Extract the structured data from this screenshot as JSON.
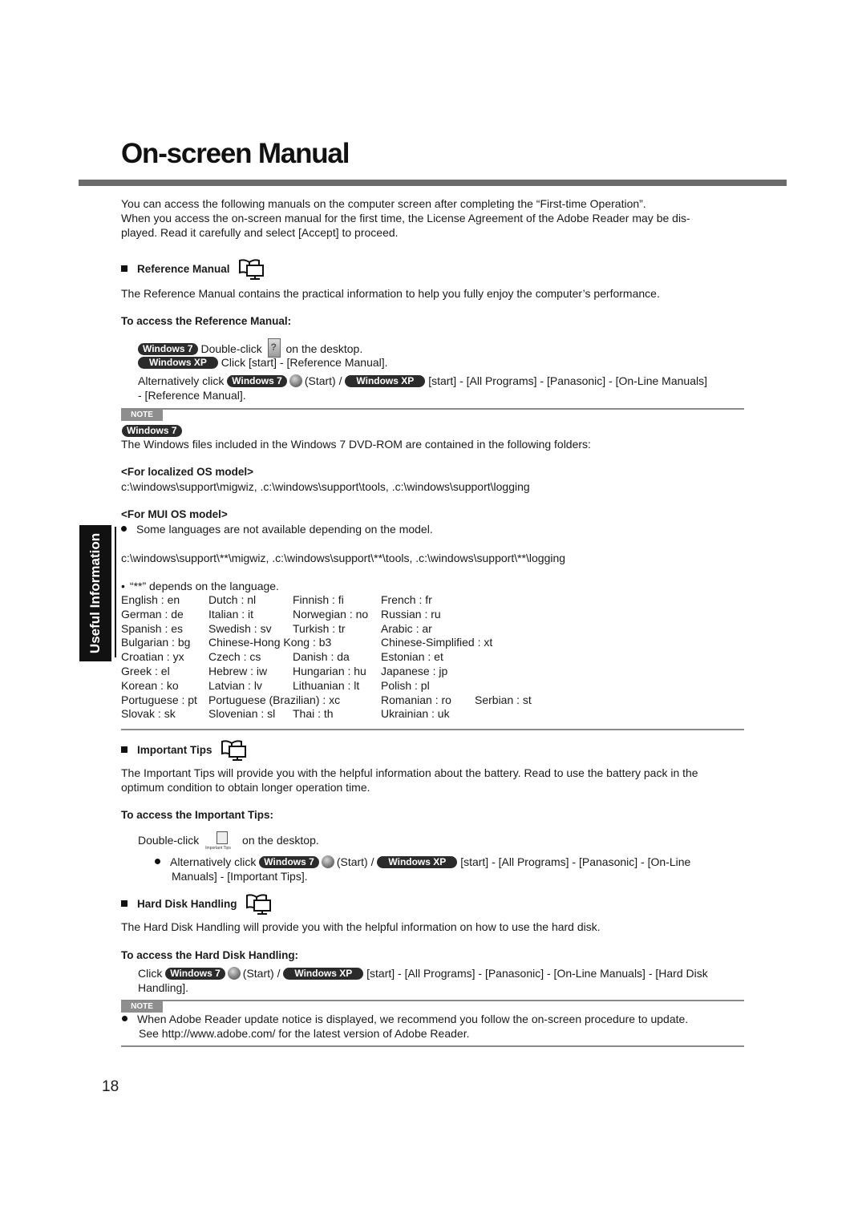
{
  "page": {
    "title": "On-screen Manual",
    "side_tab": "Useful Information",
    "page_number": "18"
  },
  "intro": {
    "line1": "You can access the following manuals on the computer screen after completing the “First-time Operation”.",
    "line2": "When you access the on-screen manual for the first time, the License Agreement of the Adobe Reader may be dis-",
    "line3": "played. Read it carefully and select [Accept] to proceed."
  },
  "badges": {
    "win7": "Windows 7",
    "winxp": "Windows XP",
    "note": "NOTE"
  },
  "reference_manual": {
    "heading": "Reference Manual",
    "description": "The Reference Manual contains the practical information to help you fully enjoy the computer’s performance.",
    "access_heading": "To access the Reference Manual:",
    "win7_pre": "Double-click",
    "win7_post": "on the desktop.",
    "xp_text": "Click [start] - [Reference Manual].",
    "alt_pre": "Alternatively click",
    "alt_start": "(Start) /",
    "alt_path": "[start] - [All Programs] - [Panasonic] - [On-Line Manuals]",
    "alt_path2": "- [Reference Manual]."
  },
  "note1": {
    "text": "The Windows files included in the Windows 7 DVD-ROM are contained in the following folders:",
    "localized_heading": "<For localized OS model>",
    "localized_path": "c:\\windows\\support\\migwiz, .c:\\windows\\support\\tools, .c:\\windows\\support\\logging",
    "mui_heading": "<For MUI OS model>",
    "mui_bullet": "Some languages are not available depending on the model.",
    "mui_path": "c:\\windows\\support\\**\\migwiz, .c:\\windows\\support\\**\\tools, .c:\\windows\\support\\**\\logging",
    "depends": "“**” depends on the language.",
    "languages": [
      [
        "English : en",
        "Dutch : nl",
        "Finnish : fi",
        "French : fr",
        ""
      ],
      [
        "German : de",
        "Italian : it",
        "Norwegian : no",
        "Russian : ru",
        ""
      ],
      [
        "Spanish : es",
        "Swedish : sv",
        "Turkish : tr",
        "Arabic : ar",
        ""
      ],
      [
        "Bulgarian : bg",
        "Chinese-Hong Kong : b3",
        "",
        "Chinese-Simplified : xt",
        ""
      ],
      [
        "Croatian : yx",
        "Czech : cs",
        "Danish : da",
        "Estonian : et",
        ""
      ],
      [
        "Greek : el",
        "Hebrew : iw",
        "Hungarian : hu",
        "Japanese : jp",
        ""
      ],
      [
        "Korean : ko",
        "Latvian : lv",
        "Lithuanian : lt",
        "Polish : pl",
        ""
      ],
      [
        "Portuguese : pt",
        "Portuguese (Brazilian) : xc",
        "",
        "Romanian : ro",
        "Serbian : st"
      ],
      [
        "Slovak : sk",
        "Slovenian : sl",
        "Thai : th",
        "Ukrainian : uk",
        ""
      ]
    ]
  },
  "important_tips": {
    "heading": "Important Tips",
    "description1": "The Important Tips will provide you with the helpful information about the battery. Read to use the battery pack in the",
    "description2": "optimum condition to obtain longer operation time.",
    "access_heading": "To access the Important Tips:",
    "dbl_pre": "Double-click",
    "icon_label": "Important Tips",
    "dbl_post": "on the desktop.",
    "alt_pre": "Alternatively click",
    "alt_start": "(Start) /",
    "alt_path": "[start] - [All Programs] - [Panasonic] - [On-Line",
    "alt_path2": "Manuals] - [Important Tips]."
  },
  "hard_disk": {
    "heading": "Hard Disk Handling",
    "description": "The Hard Disk Handling will provide you with the helpful information on how to use the hard disk.",
    "access_heading": "To access the Hard Disk Handling:",
    "click": "Click",
    "alt_start": "(Start) /",
    "path": "[start] - [All Programs] - [Panasonic] - [On-Line Manuals] - [Hard Disk",
    "path2": "Handling]."
  },
  "note2": {
    "line1": "When Adobe Reader update notice is displayed, we recommend you follow the on-screen procedure to update.",
    "line2": "See http://www.adobe.com/ for the latest version of Adobe Reader."
  }
}
